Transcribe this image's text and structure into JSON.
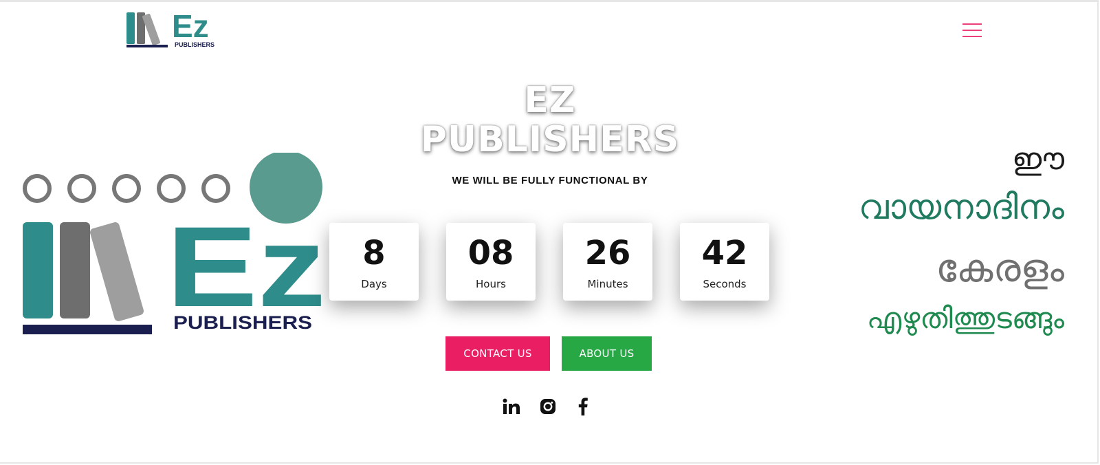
{
  "header": {
    "logo_text": "Ez",
    "logo_subtext": "PUBLISHERS",
    "menu_icon": "hamburger-icon"
  },
  "big_logo": {
    "text": "Ez",
    "subtext": "PUBLISHERS"
  },
  "hero": {
    "title_line1": "EZ",
    "title_line2": "PUBLISHERS",
    "tagline": "WE WILL BE FULLY FUNCTIONAL BY"
  },
  "countdown": [
    {
      "value": "8",
      "label": "Days"
    },
    {
      "value": "08",
      "label": "Hours"
    },
    {
      "value": "26",
      "label": "Minutes"
    },
    {
      "value": "42",
      "label": "Seconds"
    }
  ],
  "buttons": {
    "contact": "CONTACT US",
    "about": "ABOUT US"
  },
  "social": [
    {
      "name": "linkedin-icon"
    },
    {
      "name": "instagram-icon"
    },
    {
      "name": "facebook-icon"
    }
  ],
  "slogan": {
    "line1": "ഈ",
    "line2": "വായനാദിനം",
    "line3": "കേരളം",
    "line4": "എഴുതിത്തുടങ്ങും"
  },
  "colors": {
    "teal": "#2e8c8a",
    "navy": "#1b1f4f",
    "pink": "#e91e63",
    "green": "#28a745"
  }
}
